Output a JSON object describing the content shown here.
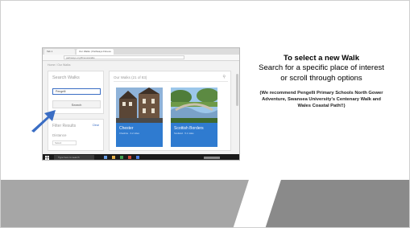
{
  "browser": {
    "tabs": [
      "Tab 1",
      "Our Walks | Pathways Fitness"
    ],
    "address": "pathways.org/fitness/walks"
  },
  "app": {
    "breadcrumb": "Home / Our Walks",
    "search_panel": {
      "title": "Search Walks",
      "input_value": "Pengelli",
      "button_label": "Search"
    },
    "filter_panel": {
      "title": "Filter Results",
      "clear_label": "Clear",
      "distance_label": "Distance",
      "distance_value": "Select"
    },
    "main_panel": {
      "title": "Our Walks (21 of 83)",
      "search_icon": "search-icon"
    },
    "cards": [
      {
        "name": "Chester",
        "subtitle": "Cheshire · 3.2 miles"
      },
      {
        "name": "Scottish Borders",
        "subtitle": "Scotland · 5.1 miles"
      }
    ],
    "taskbar_search": "Type here to search"
  },
  "slide": {
    "heading": "To select a new Walk",
    "body": "Search for a specific place of interest or scroll through options",
    "note": "(We recommend Pengelli Primary Schools North Gower Adventure, Swansea University's Centenary Walk and Wales Coastal Path!!)"
  },
  "colors": {
    "accent_blue": "#2f7bd0",
    "arrow_blue": "#3a6dc4",
    "band_light": "#a6a6a6",
    "band_dark": "#7f7f7f"
  }
}
